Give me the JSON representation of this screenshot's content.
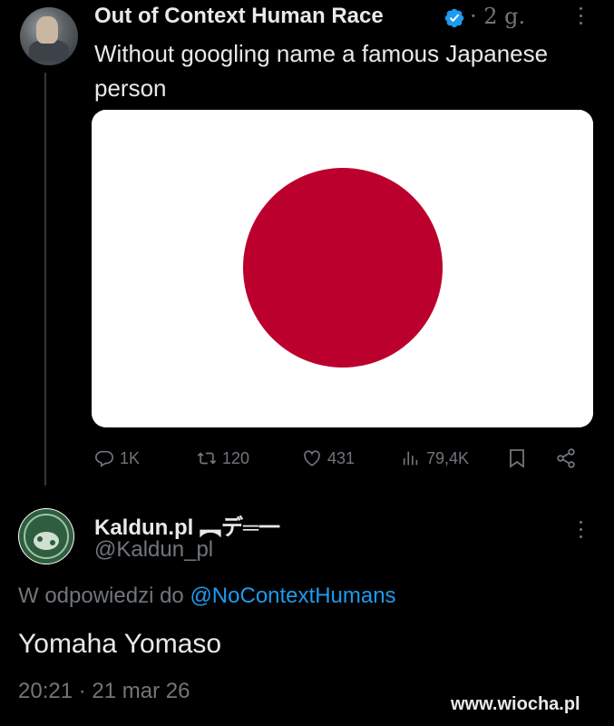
{
  "tweet": {
    "author_name": "Out of Context Human Race",
    "time": "· 2 g.",
    "text": "Without googling name a famous Japanese person",
    "media": {
      "flag_bg": "#ffffff",
      "flag_circle": "#bc002d"
    },
    "stats": {
      "replies": "1K",
      "retweets": "120",
      "likes": "431",
      "views": "79,4K"
    }
  },
  "reply": {
    "author_name": "Kaldun.pl ︻デ═一",
    "handle": "@Kaldun_pl",
    "reply_prefix": "W odpowiedzi do ",
    "reply_mention": "@NoContextHumans",
    "text": "Yomaha Yomaso",
    "timestamp": "20:21 · 21 mar 26"
  },
  "watermark": "www.wiocha.pl",
  "colors": {
    "background": "#000000",
    "text_primary": "#e7e9ea",
    "text_secondary": "#71767b",
    "accent": "#1d9bf0"
  },
  "icons": {
    "verified": "verified-badge-icon",
    "more": "more-dots-icon",
    "reply": "reply-icon",
    "retweet": "retweet-icon",
    "like": "heart-icon",
    "views": "views-chart-icon",
    "bookmark": "bookmark-icon",
    "share": "share-icon"
  }
}
